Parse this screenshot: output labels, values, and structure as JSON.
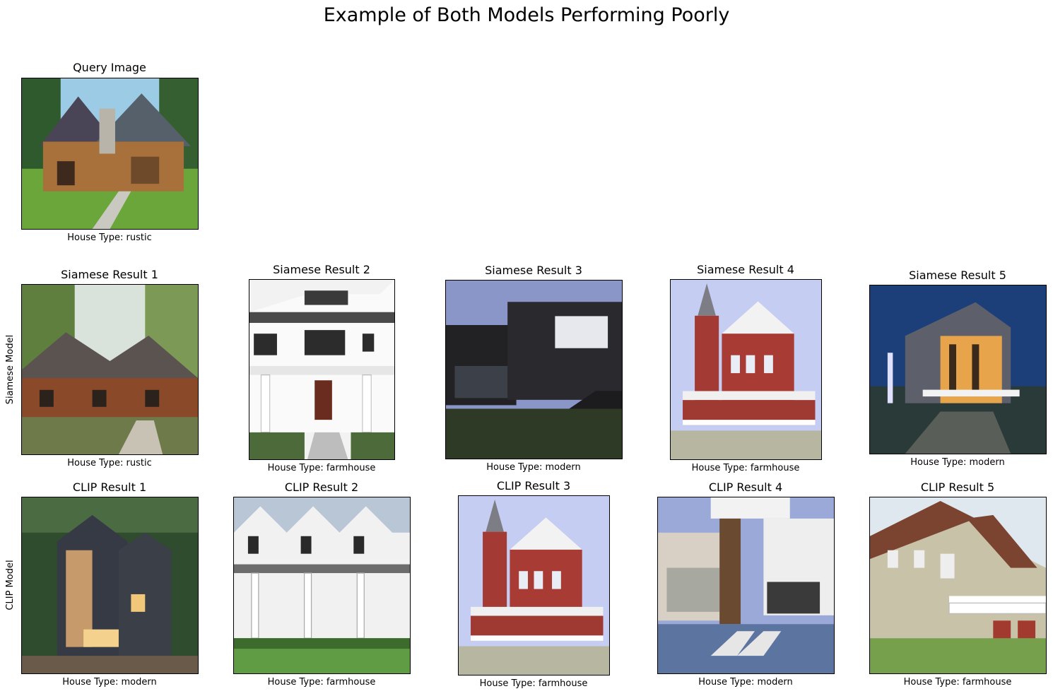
{
  "suptitle": "Example of Both Models Performing Poorly",
  "row_labels": {
    "siamese": "Siamese Model",
    "clip": "CLIP Model"
  },
  "query": {
    "title": "Query Image",
    "caption": "House Type: rustic"
  },
  "siamese": [
    {
      "title": "Siamese Result 1",
      "caption": "House Type: rustic"
    },
    {
      "title": "Siamese Result 2",
      "caption": "House Type: farmhouse"
    },
    {
      "title": "Siamese Result 3",
      "caption": "House Type: modern"
    },
    {
      "title": "Siamese Result 4",
      "caption": "House Type: farmhouse"
    },
    {
      "title": "Siamese Result 5",
      "caption": "House Type: modern"
    }
  ],
  "clip": [
    {
      "title": "CLIP Result 1",
      "caption": "House Type: modern"
    },
    {
      "title": "CLIP Result 2",
      "caption": "House Type: farmhouse"
    },
    {
      "title": "CLIP Result 3",
      "caption": "House Type: farmhouse"
    },
    {
      "title": "CLIP Result 4",
      "caption": "House Type: modern"
    },
    {
      "title": "CLIP Result 5",
      "caption": "House Type: farmhouse"
    }
  ]
}
